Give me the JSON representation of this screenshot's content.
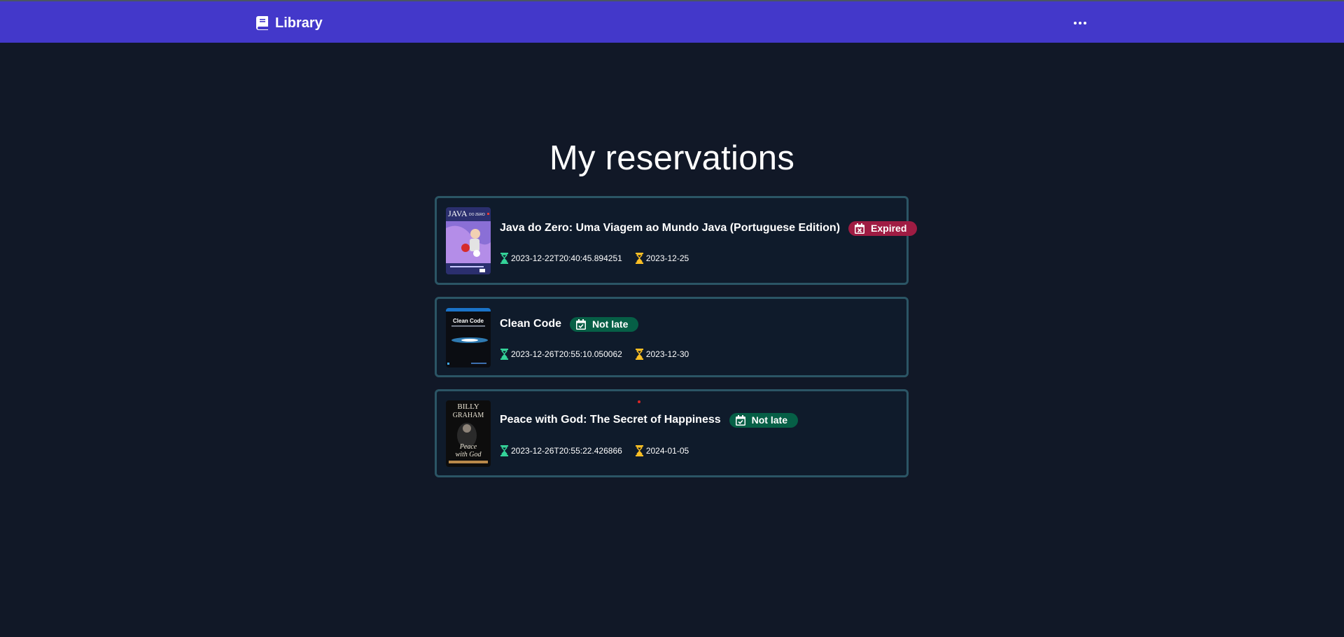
{
  "navbar": {
    "brand": "Library",
    "brand_icon": "book-icon",
    "menu_icon": "ellipsis-icon",
    "background": "#4338ca"
  },
  "page": {
    "title": "My reservations",
    "background": "#111827"
  },
  "reservations": [
    {
      "title": "Java do Zero: Uma Viagem ao Mundo Java (Portuguese Edition)",
      "status": "Expired",
      "status_icon": "calendar-x-icon",
      "status_color": "#9f1c43",
      "reserved_at": "2023-12-22T20:40:45.894251",
      "due_date": "2023-12-25",
      "cover": {
        "heading": "JAVA",
        "subheading": "DO ZERO"
      }
    },
    {
      "title": "Clean Code",
      "status": "Not late",
      "status_icon": "calendar-check-icon",
      "status_color": "#065f46",
      "reserved_at": "2023-12-26T20:55:10.050062",
      "due_date": "2023-12-30",
      "cover": {
        "heading": "Clean Code"
      }
    },
    {
      "title": "Peace with God: The Secret of Happiness",
      "status": "Not late",
      "status_icon": "calendar-check-icon",
      "status_color": "#065f46",
      "reserved_at": "2023-12-26T20:55:22.426866",
      "due_date": "2024-01-05",
      "cover": {
        "author_first": "BILLY",
        "author_last": "GRAHAM",
        "title_line1": "Peace",
        "title_line2": "with God"
      }
    }
  ],
  "icons": {
    "reserved_icon": "hourglass-start-icon",
    "reserved_color": "#34d399",
    "due_icon": "hourglass-end-icon",
    "due_color": "#fbbf24"
  }
}
